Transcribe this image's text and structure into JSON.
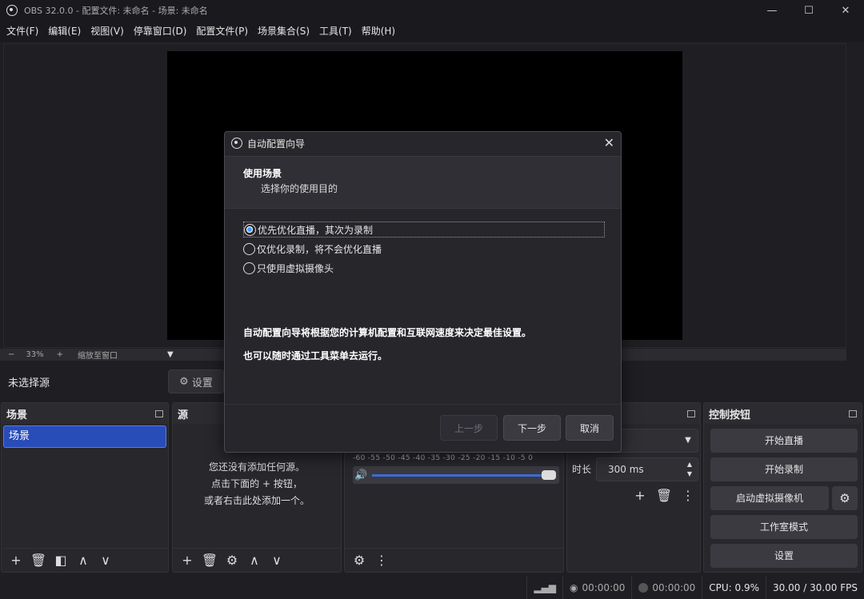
{
  "window": {
    "title": "OBS 32.0.0 - 配置文件: 未命名 - 场景: 未命名",
    "minimize": "—",
    "maximize": "☐",
    "close": "✕"
  },
  "menu": [
    "文件(F)",
    "编辑(E)",
    "视图(V)",
    "停靠窗口(D)",
    "配置文件(P)",
    "场景集合(S)",
    "工具(T)",
    "帮助(H)"
  ],
  "zoom": {
    "minus": "−",
    "value": "33%",
    "plus": "+",
    "mode": "缩放至窗口",
    "caret": "▼"
  },
  "source_bar": {
    "no_source": "未选择源",
    "settings_label": "设置"
  },
  "scenes": {
    "title": "场景",
    "items": [
      "场景"
    ]
  },
  "sources": {
    "title": "源",
    "empty_line1": "您还没有添加任何源。",
    "empty_line2": "点击下面的 + 按钮，",
    "empty_line3": "或者右击此处添加一个。"
  },
  "mixer": {
    "scale": "-60 -55 -50 -45 -40 -35 -30 -25 -20 -15 -10 -5 0"
  },
  "transitions": {
    "duration_label": "时长",
    "duration_value": "300 ms"
  },
  "controls": {
    "title": "控制按钮",
    "start_stream": "开始直播",
    "start_record": "开始录制",
    "virtual_cam": "启动虚拟摄像机",
    "studio_mode": "工作室模式",
    "settings": "设置"
  },
  "status": {
    "stream_time": "00:00:00",
    "record_time": "00:00:00",
    "cpu": "CPU: 0.9%",
    "fps": "30.00 / 30.00 FPS"
  },
  "dialog": {
    "title": "自动配置向导",
    "close": "✕",
    "header_title": "使用场景",
    "header_subtitle": "选择你的使用目的",
    "options": [
      "优先优化直播，其次为录制",
      "仅优化录制，将不会优化直播",
      "只使用虚拟摄像头"
    ],
    "selected_index": 0,
    "info1": "自动配置向导将根据您的计算机配置和互联网速度来决定最佳设置。",
    "info2": "也可以随时通过工具菜单去运行。",
    "back": "上一步",
    "next": "下一步",
    "cancel": "取消"
  }
}
